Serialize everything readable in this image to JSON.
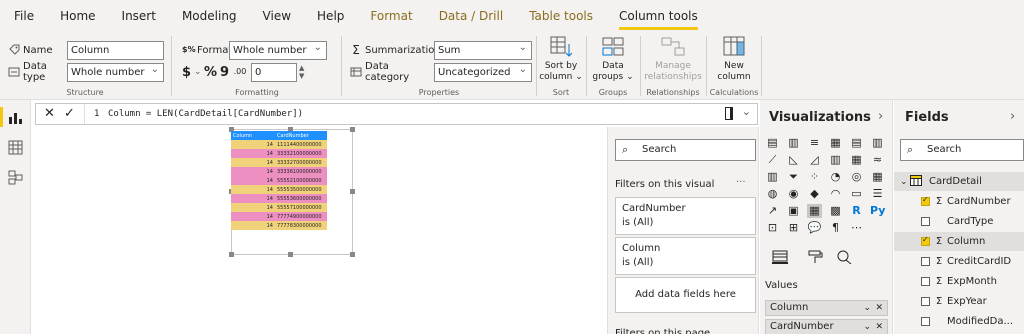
{
  "menu": {
    "tabs": [
      "File",
      "Home",
      "Insert",
      "Modeling",
      "View",
      "Help",
      "Format",
      "Data / Drill",
      "Table tools",
      "Column tools"
    ]
  },
  "ribbon": {
    "structure": {
      "name_label": "Name",
      "name_value": "Column",
      "datatype_label": "Data type",
      "datatype_value": "Whole number",
      "group_label": "Structure"
    },
    "formatting": {
      "format_label": "Format",
      "format_value": "Whole number",
      "currency_symbol": "$",
      "percent_symbol": "%",
      "comma_symbol": "9",
      "decimal_value": "0",
      "group_label": "Formatting"
    },
    "properties": {
      "summarization_label": "Summarization",
      "summarization_value": "Sum",
      "category_label": "Data category",
      "category_value": "Uncategorized",
      "group_label": "Properties"
    },
    "sort": {
      "button_line1": "Sort by",
      "button_line2": "column",
      "group_label": "Sort"
    },
    "groups": {
      "button_line1": "Data",
      "button_line2": "groups",
      "group_label": "Groups"
    },
    "relationships": {
      "button_line1": "Manage",
      "button_line2": "relationships",
      "group_label": "Relationships"
    },
    "calculations": {
      "button_line1": "New",
      "button_line2": "column",
      "group_label": "Calculations"
    }
  },
  "formula_bar": {
    "line_number": "1",
    "formula": "Column = LEN(CardDetail[CardNumber])"
  },
  "table": {
    "headers": [
      "Column",
      "CardNumber"
    ],
    "rows": [
      [
        "14",
        "11114400000000"
      ],
      [
        "14",
        "33332100000000"
      ],
      [
        "14",
        "33332700000000"
      ],
      [
        "14",
        "33336100000000"
      ],
      [
        "14",
        "55552100000000"
      ],
      [
        "14",
        "55553500000000"
      ],
      [
        "14",
        "55553600000000"
      ],
      [
        "14",
        "55557100000000"
      ],
      [
        "14",
        "77774900000000"
      ],
      [
        "14",
        "77778300000000"
      ]
    ],
    "row_colors": [
      "#f0d27a",
      "#ee8fc2",
      "#f0d27a",
      "#ee8fc2",
      "#ee8fc2",
      "#f0d27a",
      "#ee8fc2",
      "#f0d27a",
      "#ee8fc2",
      "#f0d27a"
    ]
  },
  "filters": {
    "search_placeholder": "Search",
    "section_title": "Filters on this visual",
    "more": "···",
    "cards": [
      {
        "field": "CardNumber",
        "state": "is (All)"
      },
      {
        "field": "Column",
        "state": "is (All)"
      }
    ],
    "add_label": "Add data fields here",
    "next_section": "Filters on this page"
  },
  "visualizations": {
    "title": "Visualizations",
    "values_label": "Values",
    "value_fields": [
      "Column",
      "CardNumber"
    ]
  },
  "fields": {
    "title": "Fields",
    "search_placeholder": "Search",
    "table_name": "CardDetail",
    "items": [
      {
        "name": "CardNumber",
        "sigma": "Σ",
        "checked": true
      },
      {
        "name": "CardType",
        "sigma": "",
        "checked": false
      },
      {
        "name": "Column",
        "sigma": "Σ",
        "checked": true
      },
      {
        "name": "CreditCardID",
        "sigma": "Σ",
        "checked": false
      },
      {
        "name": "ExpMonth",
        "sigma": "Σ",
        "checked": false
      },
      {
        "name": "ExpYear",
        "sigma": "Σ",
        "checked": false
      },
      {
        "name": "ModifiedDa...",
        "sigma": "",
        "checked": false
      }
    ]
  },
  "colors": {
    "accent": "#f2c811",
    "header_blue": "#1e90ff",
    "row_pink": "#ee8fc2",
    "row_yellow": "#f0d27a"
  }
}
